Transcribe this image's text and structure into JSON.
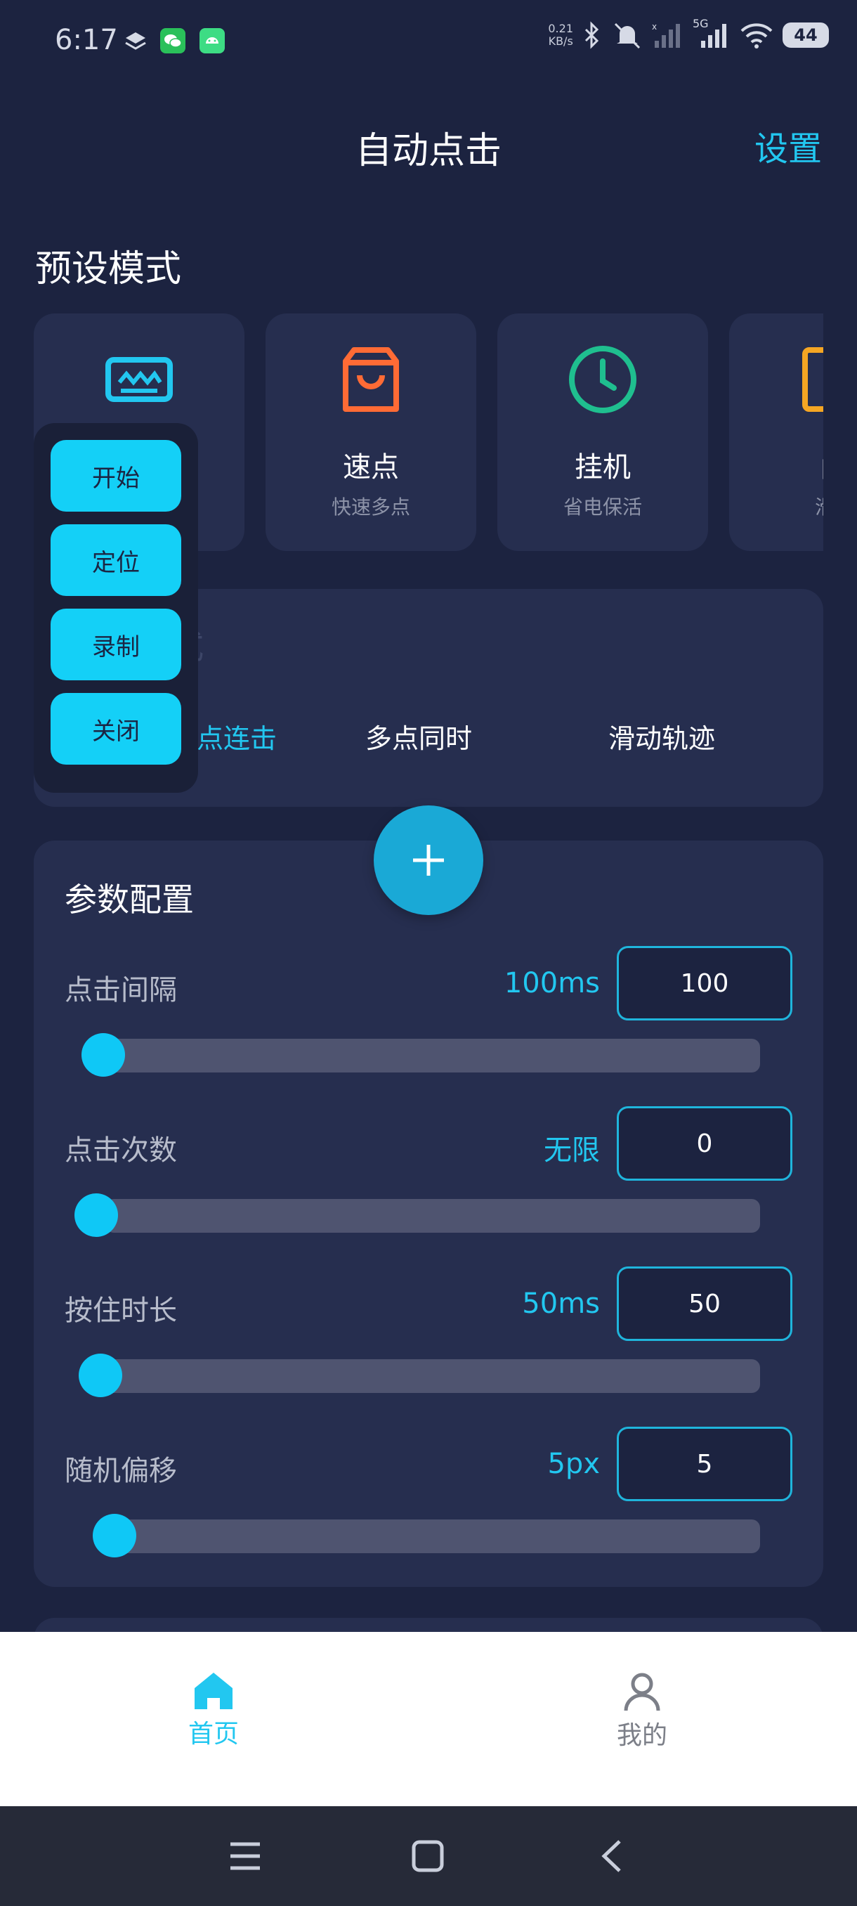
{
  "status_bar": {
    "time": "6:17",
    "net_speed_value": "0.21",
    "net_speed_unit": "KB/s",
    "network": "5G",
    "battery": "44"
  },
  "header": {
    "title": "自动点击",
    "settings_label": "设置"
  },
  "presets": {
    "title": "预设模式",
    "cards": [
      {
        "icon": "keyboard-icon",
        "color": "#22c7f0",
        "title": "",
        "subtitle": ""
      },
      {
        "icon": "shopping-bag-icon",
        "color": "#ff6b35",
        "title": "速点",
        "subtitle": "快速多点"
      },
      {
        "icon": "clock-icon",
        "color": "#1fbf8f",
        "title": "挂机",
        "subtitle": "省电保活"
      },
      {
        "icon": "bookmark-icon",
        "color": "#f5a623",
        "title": "阅",
        "subtitle": "滑动"
      }
    ]
  },
  "mode_panel": {
    "faded_label": "式",
    "tabs": [
      {
        "label": "点连击",
        "active": true
      },
      {
        "label": "多点同时",
        "active": false
      },
      {
        "label": "滑动轨迹",
        "active": false
      }
    ]
  },
  "floating_menu": {
    "start": "开始",
    "locate": "定位",
    "record": "录制",
    "close": "关闭"
  },
  "params": {
    "title": "参数配置",
    "items": [
      {
        "label": "点击间隔",
        "display": "100ms",
        "input": "100",
        "fraction": 0.0
      },
      {
        "label": "点击次数",
        "display": "无限",
        "input": "0",
        "fraction": 0.0
      },
      {
        "label": "按住时长",
        "display": "50ms",
        "input": "50",
        "fraction": 0.0
      },
      {
        "label": "随机偏移",
        "display": "5px",
        "input": "5",
        "fraction": 0.0
      }
    ]
  },
  "bottom_nav": {
    "home": "首页",
    "mine": "我的",
    "active_color": "#22c7f0",
    "inactive_color": "#7c7f88"
  },
  "colors": {
    "background": "#1c2340",
    "card": "#262e4f",
    "accent": "#22c7f0"
  }
}
